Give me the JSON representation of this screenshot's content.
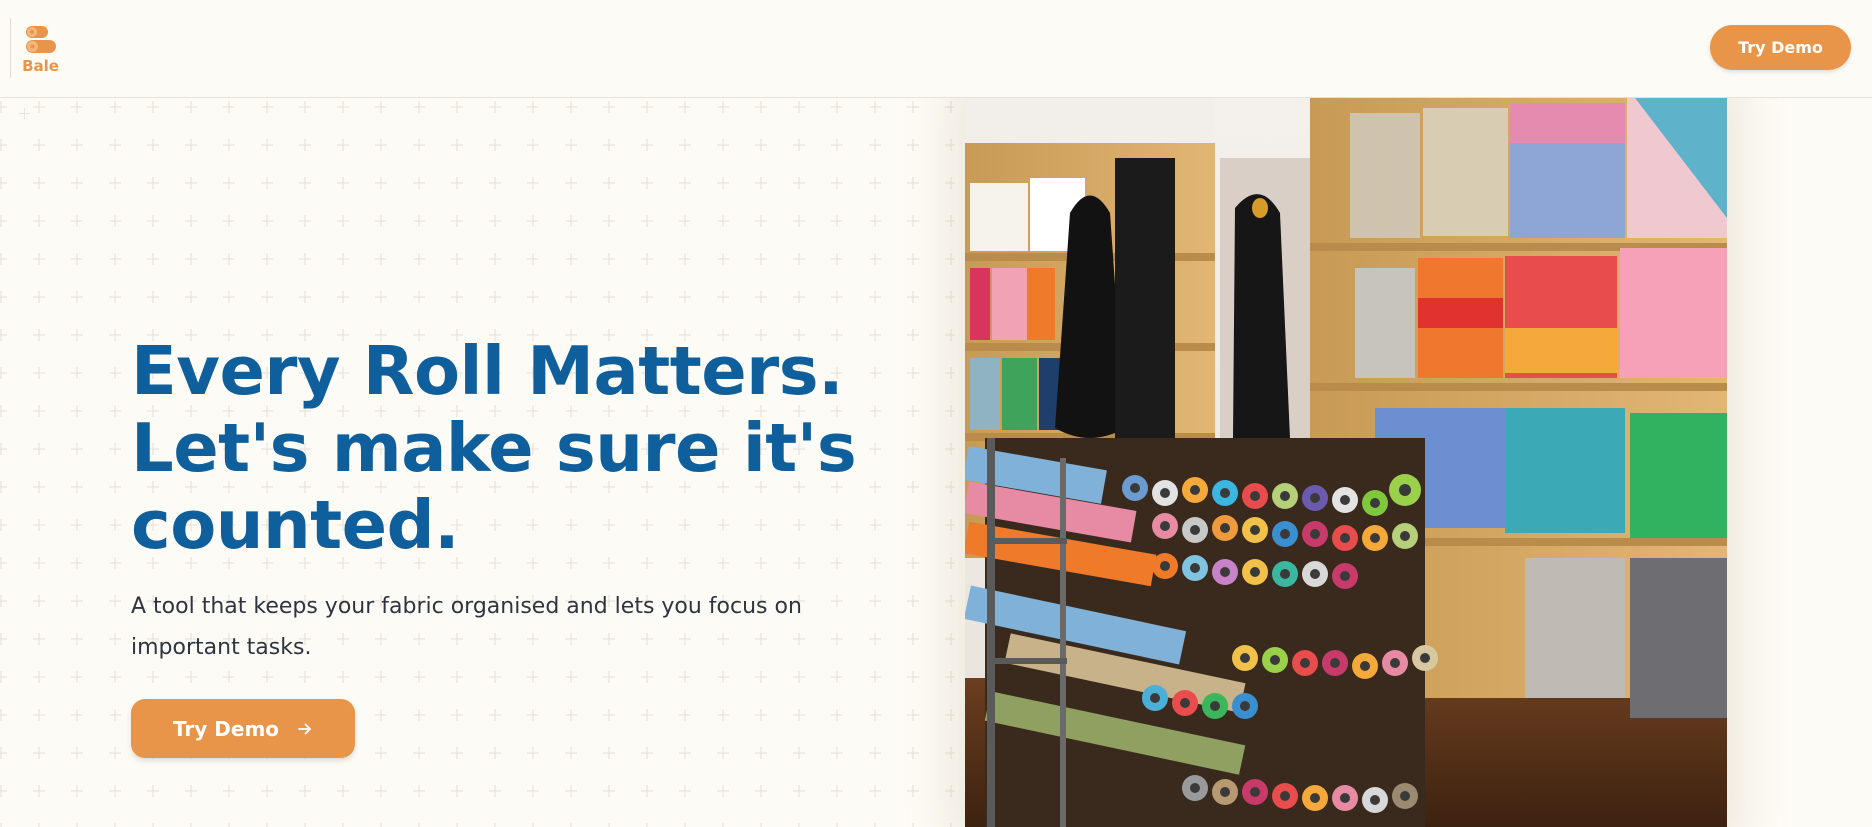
{
  "header": {
    "logo_text": "Bale",
    "try_demo_label": "Try Demo"
  },
  "hero": {
    "headline_line1": "Every Roll Matters.",
    "headline_line2": "Let's make sure it's",
    "headline_line3": "counted.",
    "subtitle_line1": "A tool that keeps your fabric organised and lets you focus on",
    "subtitle_line2": "important tasks.",
    "cta_label": "Try Demo",
    "image_alt": "Fabric shop with colorful rolls of fabric and mannequins"
  },
  "colors": {
    "brand_orange": "#e8954a",
    "headline_blue": "#0e5f9b",
    "background": "#fdfbf5"
  }
}
